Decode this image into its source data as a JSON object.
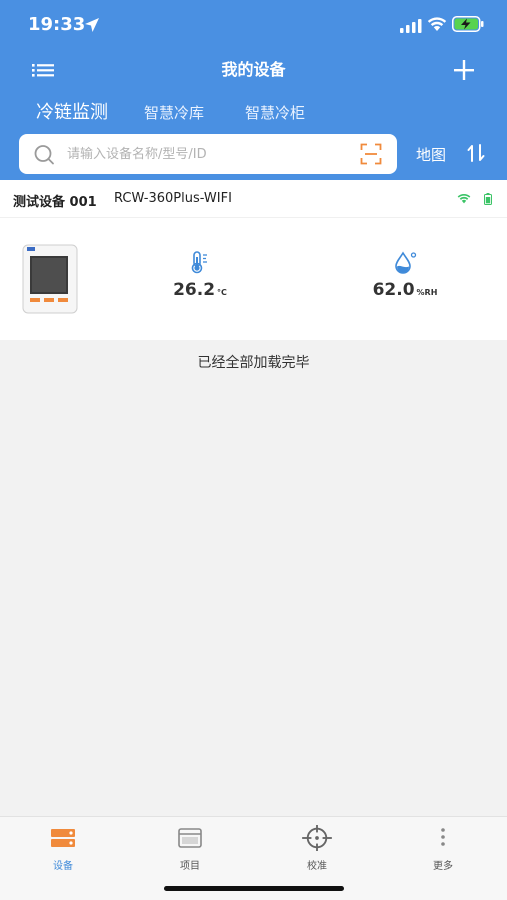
{
  "status_bar": {
    "time": "19:33"
  },
  "header": {
    "title": "我的设备",
    "tabs": [
      {
        "label": "冷链监测"
      },
      {
        "label": "智慧冷库"
      },
      {
        "label": "智慧冷柜"
      }
    ],
    "search": {
      "placeholder": "请输入设备名称/型号/ID",
      "value": ""
    },
    "map_label": "地图"
  },
  "device": {
    "name": "测试设备 001",
    "model": "RCW-360Plus-WIFI",
    "temperature": {
      "value": "26.2",
      "unit": "°C"
    },
    "humidity": {
      "value": "62.0",
      "unit": "%RH"
    }
  },
  "list_footer": "已经全部加载完毕",
  "bottom_nav": [
    {
      "label": "设备",
      "icon": "device-icon"
    },
    {
      "label": "项目",
      "icon": "project-icon"
    },
    {
      "label": "校准",
      "icon": "calibrate-icon"
    },
    {
      "label": "更多",
      "icon": "more-icon"
    }
  ],
  "colors": {
    "primary": "#4a90e2",
    "accent_orange": "#f08a3c",
    "active_tab": "#3f8ad9",
    "online_green": "#3cc467"
  }
}
